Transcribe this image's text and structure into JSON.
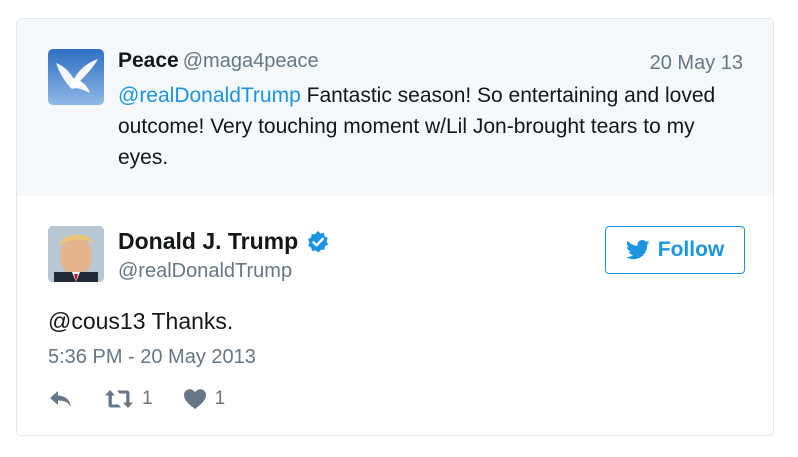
{
  "reply_to": {
    "name": "Peace",
    "handle": "@maga4peace",
    "date": "20 May 13",
    "mention": "@realDonaldTrump",
    "text": " Fantastic season! So entertaining and loved outcome! Very touching moment w/Lil Jon-brought tears to my eyes."
  },
  "tweet": {
    "name": "Donald J. Trump",
    "handle": "@realDonaldTrump",
    "verified_icon": "verified-badge-icon",
    "follow_label": "Follow",
    "text": "@cous13 Thanks.",
    "timestamp": "5:36 PM - 20 May 2013",
    "retweet_count": "1",
    "like_count": "1"
  },
  "colors": {
    "accent": "#1b95e0",
    "secondary_text": "#657786",
    "reply_bg": "#f5f8fa",
    "border": "#e1e8ed"
  },
  "icons": [
    "reply-icon",
    "retweet-icon",
    "heart-icon",
    "twitter-bird-icon",
    "dove-avatar",
    "profile-avatar"
  ]
}
